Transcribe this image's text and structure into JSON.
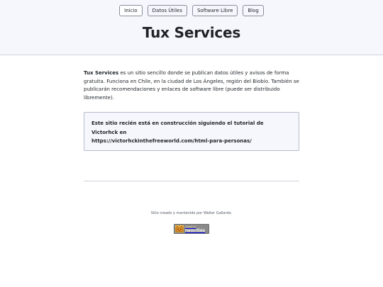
{
  "nav": {
    "items": [
      "Inicio",
      "Datos Útiles",
      "Software Libre",
      "Blog"
    ]
  },
  "header": {
    "title": "Tux Services"
  },
  "main": {
    "intro_brand": "Tux Services",
    "intro_text": " es un sitio sencillo donde se publican datos útiles y avisos de forma gratuita. Funciona en Chile, en la ciudad de Los Ángeles, región del Biobío. También se publicarán recomendaciones y enlaces de software libre (puede ser distribuido libremente).",
    "notice_line1": "Este sitio recién está en construcción siguiendo el tutorial de Victorhck en",
    "notice_link": "https://victorhckinthefreeworld.com/html-para-personas/"
  },
  "footer": {
    "credit": "Sitio creado y mantenido por Walter Gallardo.",
    "badge_small": "hosted on",
    "badge_big": "neocities"
  }
}
